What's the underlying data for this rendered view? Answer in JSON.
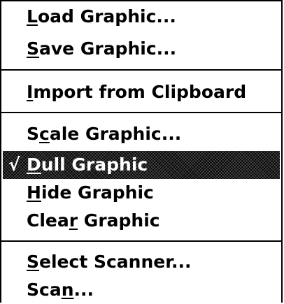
{
  "menu": {
    "items": [
      {
        "prefix": "",
        "mnemonic": "L",
        "suffix": "oad Graphic...",
        "checked": false
      },
      {
        "prefix": "",
        "mnemonic": "S",
        "suffix": "ave Graphic...",
        "checked": false
      },
      {
        "prefix": "",
        "mnemonic": "I",
        "suffix": "mport from Clipboard",
        "checked": false
      },
      {
        "prefix": "S",
        "mnemonic": "c",
        "suffix": "ale Graphic...",
        "checked": false
      },
      {
        "prefix": "",
        "mnemonic": "D",
        "suffix": "ull Graphic",
        "checked": true,
        "check_glyph": "√"
      },
      {
        "prefix": "",
        "mnemonic": "H",
        "suffix": "ide Graphic",
        "checked": false
      },
      {
        "prefix": "Clea",
        "mnemonic": "r",
        "suffix": " Graphic",
        "checked": false
      },
      {
        "prefix": "",
        "mnemonic": "S",
        "suffix": "elect Scanner...",
        "checked": false
      },
      {
        "prefix": "Sca",
        "mnemonic": "n",
        "suffix": "...",
        "checked": false
      }
    ]
  },
  "colors": {
    "menu_bg": "#ffffff",
    "text": "#000000",
    "highlight_bg": "#000000",
    "highlight_text": "#ffffff"
  }
}
